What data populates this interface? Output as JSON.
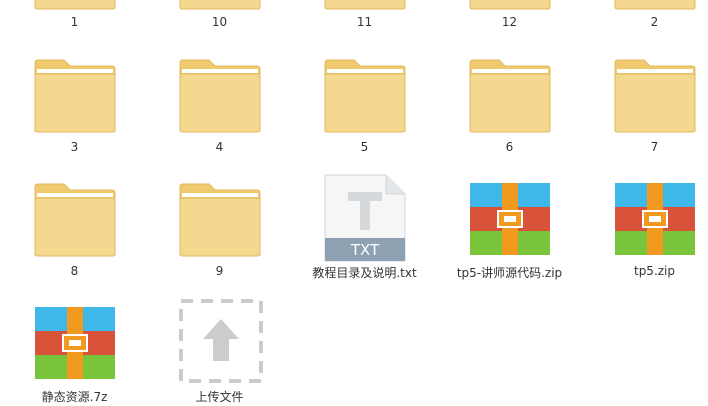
{
  "items": [
    {
      "label": "1",
      "type": "folder"
    },
    {
      "label": "10",
      "type": "folder"
    },
    {
      "label": "11",
      "type": "folder"
    },
    {
      "label": "12",
      "type": "folder"
    },
    {
      "label": "2",
      "type": "folder"
    },
    {
      "label": "3",
      "type": "folder"
    },
    {
      "label": "4",
      "type": "folder"
    },
    {
      "label": "5",
      "type": "folder"
    },
    {
      "label": "6",
      "type": "folder"
    },
    {
      "label": "7",
      "type": "folder"
    },
    {
      "label": "8",
      "type": "folder"
    },
    {
      "label": "9",
      "type": "folder"
    },
    {
      "label": "教程目录及说明.txt",
      "type": "txt",
      "badge": "TXT"
    },
    {
      "label": "tp5-讲师源代码.zip",
      "type": "archive"
    },
    {
      "label": "tp5.zip",
      "type": "archive"
    },
    {
      "label": "静态资源.7z",
      "type": "archive"
    },
    {
      "label": "上传文件",
      "type": "upload"
    }
  ],
  "colors": {
    "folder_body": "#f5d88f",
    "folder_back": "#f0ca6f",
    "folder_edge": "#e2b95c",
    "txt_band": "#8ea1b3",
    "archive_blue": "#3db8e8",
    "archive_red": "#d9533b",
    "archive_green": "#79c43a",
    "archive_orange": "#f19a1f",
    "upload_gray": "#cccccc"
  }
}
